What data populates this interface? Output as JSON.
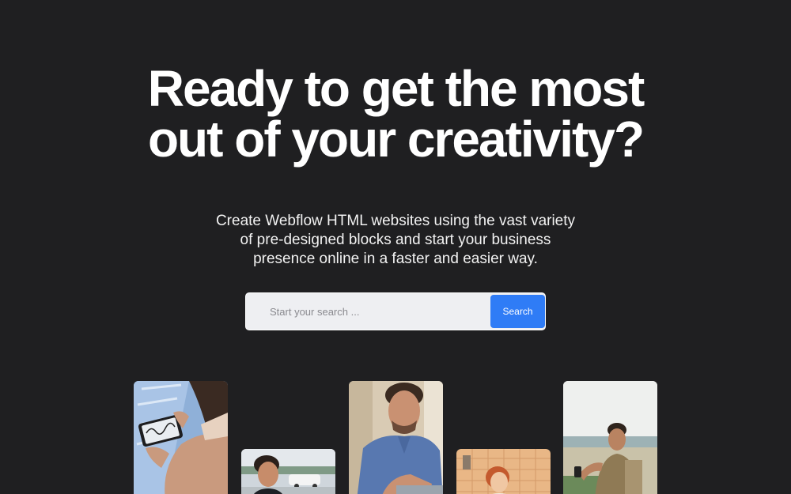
{
  "hero": {
    "title_line_1": "Ready to get the most",
    "title_line_2": "out of your creativity?",
    "subtitle_line_1": "Create Webflow HTML websites using the vast variety",
    "subtitle_line_2": "of pre-designed blocks and start your business",
    "subtitle_line_3": "presence online in a faster and easier way."
  },
  "search": {
    "placeholder": "Start your search ...",
    "button_label": "Search"
  },
  "colors": {
    "background": "#1f1f21",
    "accent": "#2f7cf6",
    "search_field": "#eeeff2"
  },
  "gallery": {
    "images": [
      "photo-hands-signing-phone",
      "photo-man-smiling-outdoors",
      "photo-man-blue-shirt-laptop",
      "photo-woman-kitchen",
      "photo-man-seaside-phone"
    ]
  }
}
